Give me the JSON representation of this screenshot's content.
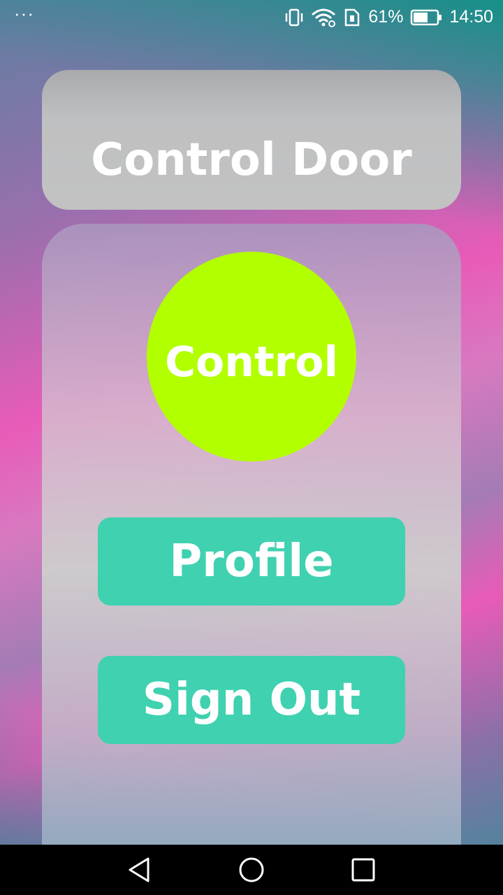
{
  "status_bar": {
    "overflow_dots": "···",
    "battery_percent": "61%",
    "time": "14:50",
    "icons": [
      "vibrate-icon",
      "wifi-icon",
      "sim-icon",
      "battery-icon"
    ]
  },
  "header": {
    "title": "Control Door"
  },
  "main": {
    "control_label": "Control",
    "control_color": "#b2ff00",
    "profile_label": "Profile",
    "signout_label": "Sign Out",
    "button_color": "#3fd1b0"
  },
  "nav_bar": {
    "icons": [
      "back-icon",
      "home-icon",
      "recents-icon"
    ]
  }
}
